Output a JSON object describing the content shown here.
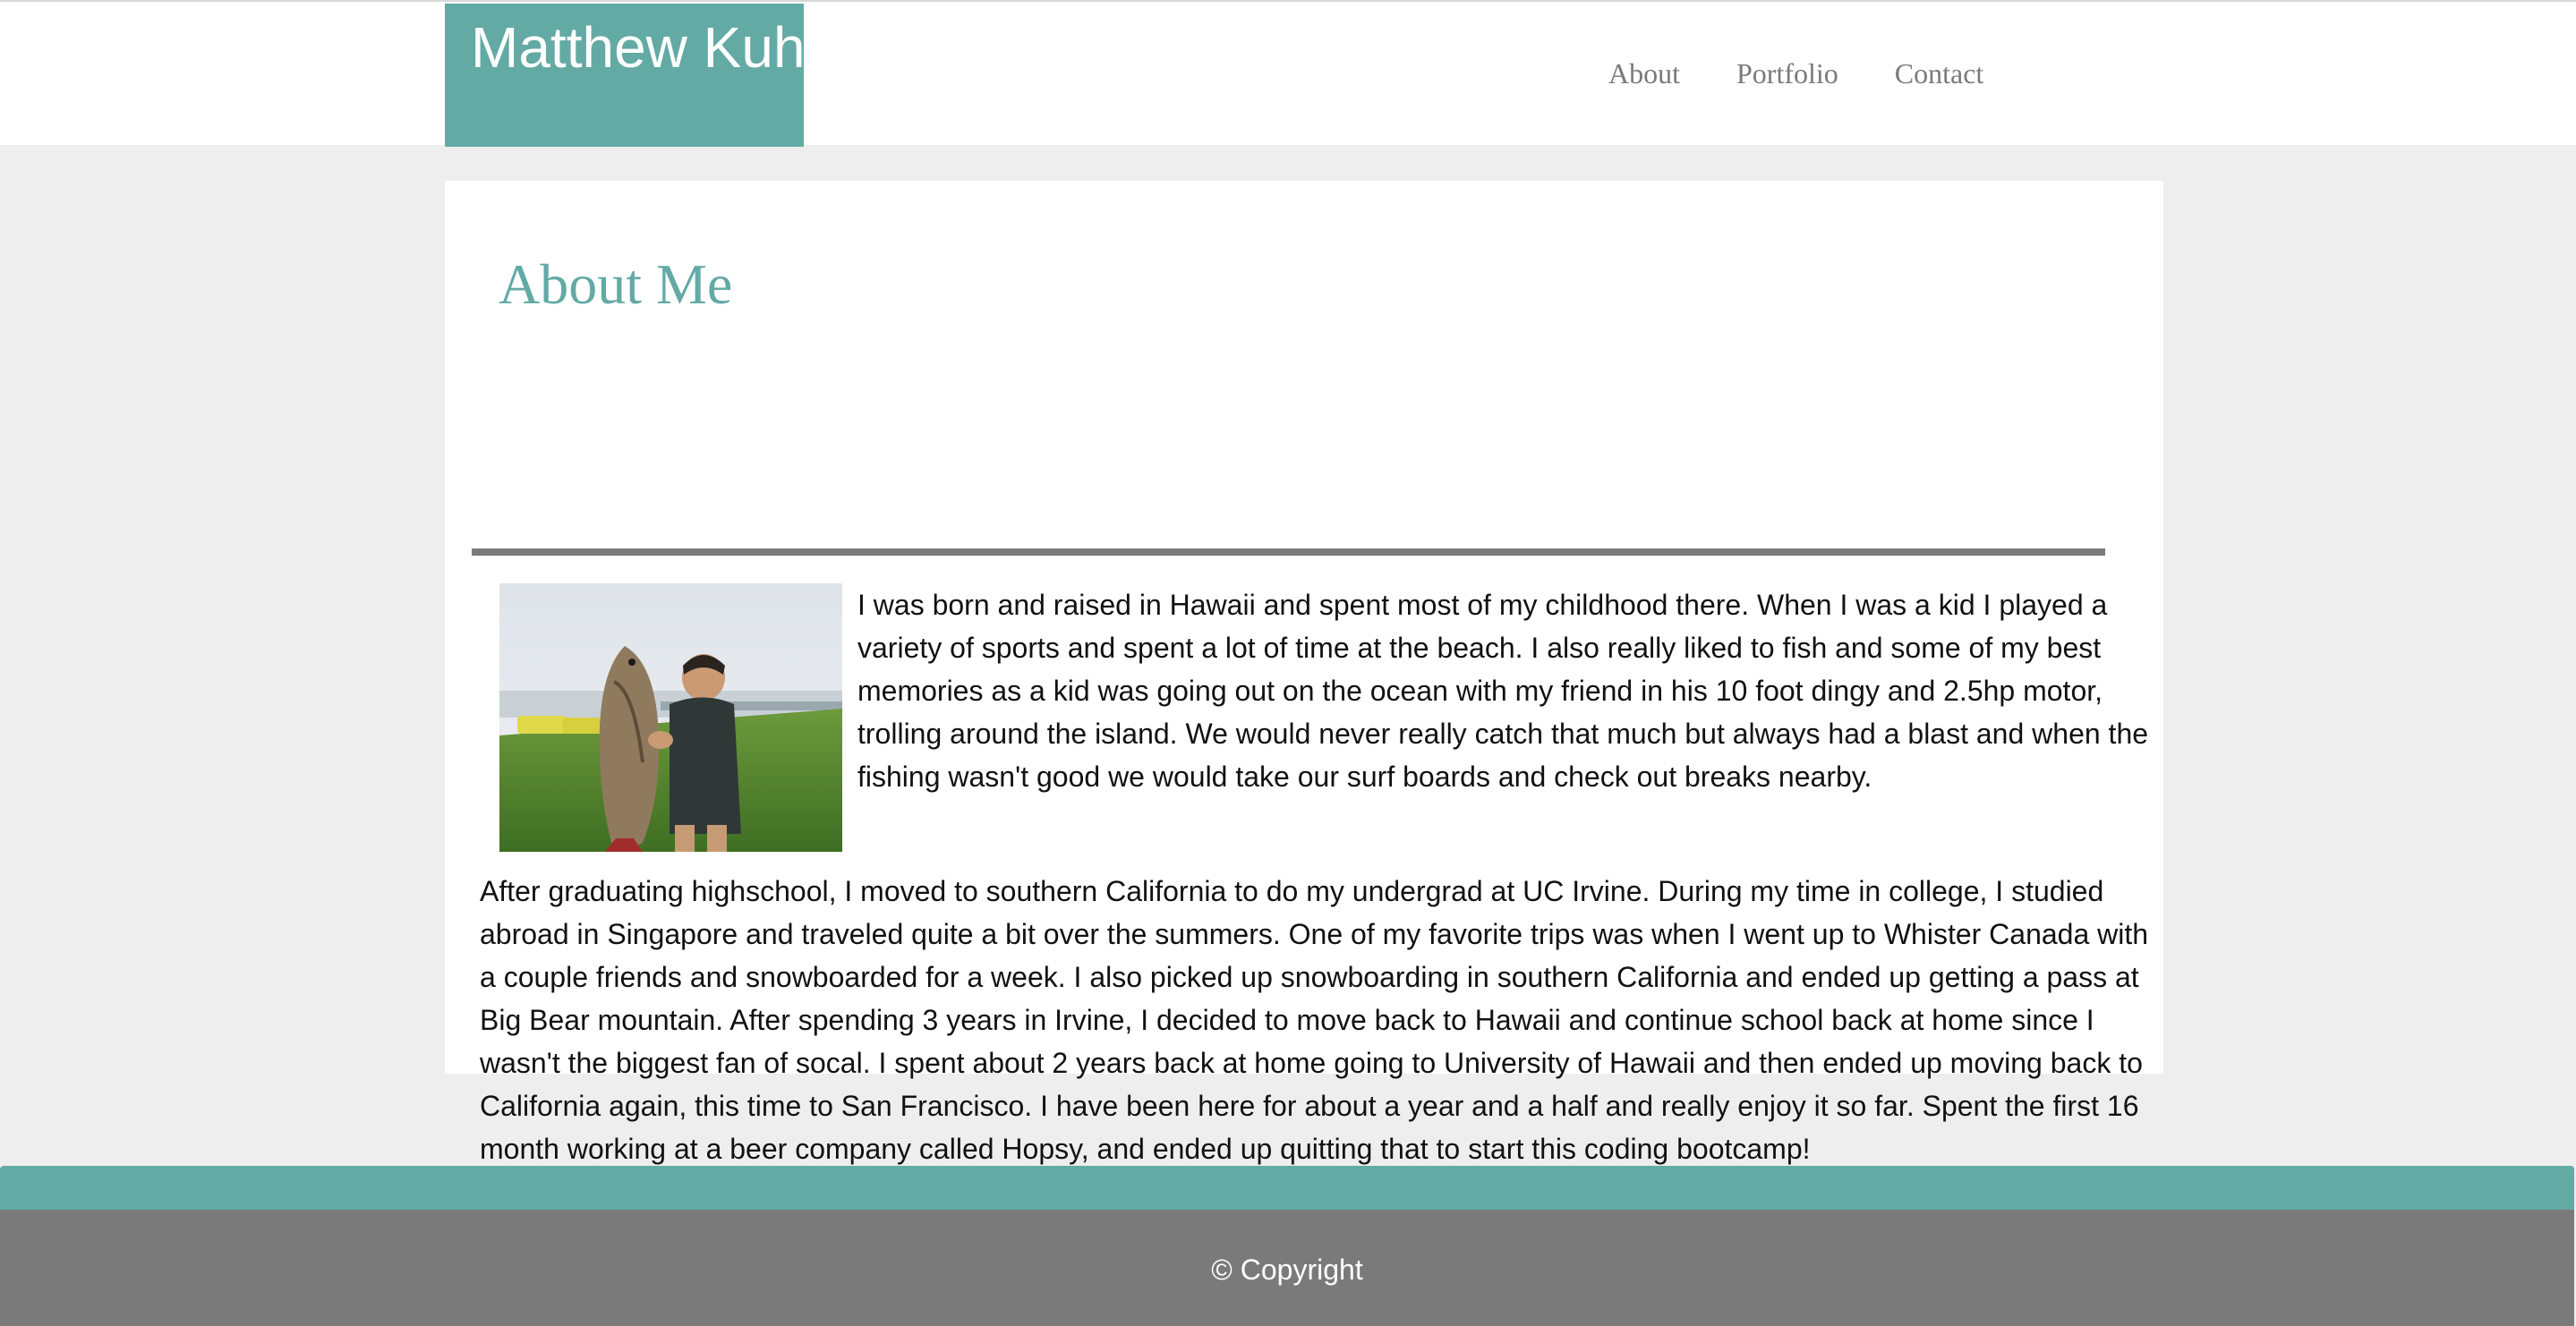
{
  "header": {
    "brand_name": "Matthew Kuh",
    "nav": [
      {
        "label": "About"
      },
      {
        "label": "Portfolio"
      },
      {
        "label": "Contact"
      }
    ]
  },
  "main": {
    "title": "About Me",
    "photo_description": "boy-holding-large-fish-photo",
    "paragraphs": [
      "I was born and raised in Hawaii and spent most of my childhood there. When I was a kid I played a variety of sports and spent a lot of time at the beach. I also really liked to fish and some of my best memories as a kid was going out on the ocean with my friend in his 10 foot dingy and 2.5hp motor, trolling around the island. We would never really catch that much but always had a blast and when the fishing wasn't good we would take our surf boards and check out breaks nearby.",
      "After graduating highschool, I moved to southern California to do my undergrad at UC Irvine. During my time in college, I studied abroad in Singapore and traveled quite a bit over the summers. One of my favorite trips was when I went up to Whister Canada with a couple friends and snowboarded for a week. I also picked up snowboarding in southern California and ended up getting a pass at Big Bear mountain. After spending 3 years in Irvine, I decided to move back to Hawaii and continue school back at home since I wasn't the biggest fan of socal. I spent about 2 years back at home going to University of Hawaii and then ended up moving back to California again, this time to San Francisco. I have been here for about a year and a half and really enjoy it so far. Spent the first 16 month working at a beer company called Hopsy, and ended up quitting that to start this coding bootcamp!"
    ]
  },
  "footer": {
    "copyright": "© Copyright"
  },
  "colors": {
    "accent": "#63aaa4",
    "footer": "#7a7a7a",
    "background": "#eeeeee",
    "nav_text": "#7a7a7a"
  }
}
